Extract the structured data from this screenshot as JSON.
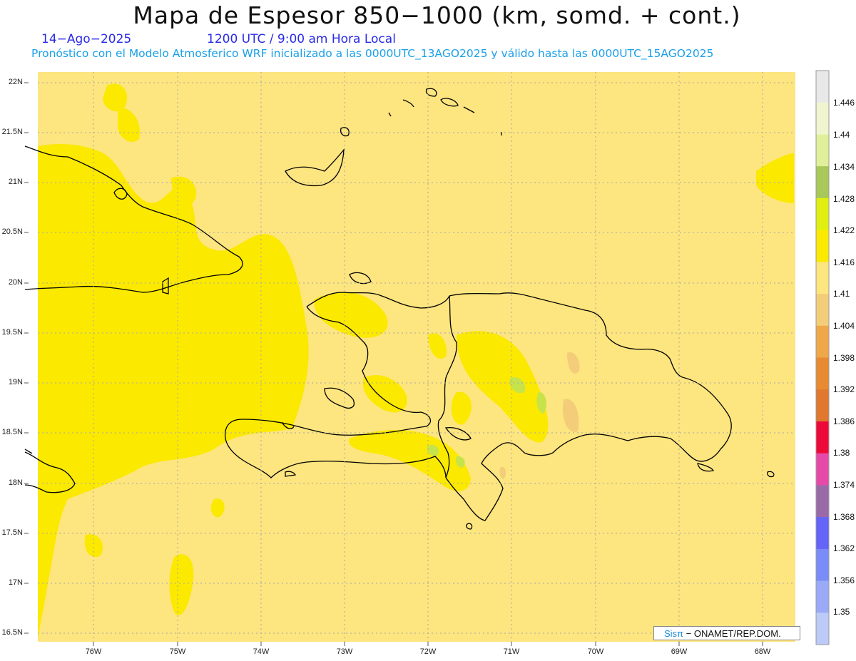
{
  "header": {
    "title": "Mapa de Espesor 850−1000 (km, somd. + cont.)",
    "date": "14−Ago−2025",
    "time": "1200 UTC / 9:00 am Hora Local",
    "forecast": "Pronóstico con el Modelo Atmosferico WRF inicializado a las 0000UTC_13AGO2025 y válido hasta las  0000UTC_15AGO2025"
  },
  "map": {
    "lat_labels": [
      "22N",
      "21.5N",
      "21N",
      "20.5N",
      "20N",
      "19.5N",
      "19N",
      "18.5N",
      "18N",
      "17.5N",
      "17N",
      "16.5N"
    ],
    "lon_labels": [
      "76W",
      "75W",
      "74W",
      "73W",
      "72W",
      "71W",
      "70W",
      "69W",
      "68W"
    ],
    "colors": {
      "background": "#fde57f",
      "yellow": "#fbe900",
      "tan": "#f3cd7a",
      "green": "#c6e34a",
      "coast": "#000000"
    }
  },
  "colorbar": {
    "labels": [
      "1.446",
      "1.44",
      "1.434",
      "1.428",
      "1.422",
      "1.416",
      "1.41",
      "1.404",
      "1.398",
      "1.392",
      "1.386",
      "1.38",
      "1.374",
      "1.368",
      "1.362",
      "1.356",
      "1.35"
    ],
    "colors": [
      "#e8e8e8",
      "#f0f5d0",
      "#e0f09a",
      "#a8c85a",
      "#e0ef10",
      "#fbe900",
      "#fde57f",
      "#f3cd7a",
      "#eea84a",
      "#e88a32",
      "#e07830",
      "#ee0a38",
      "#e64aa8",
      "#9a6aa8",
      "#6464f8",
      "#7a8cf8",
      "#9aaaf8",
      "#bccaf8"
    ]
  },
  "credit": {
    "brand": "Sisπ",
    "org": "− ONAMET/REP.DOM."
  }
}
